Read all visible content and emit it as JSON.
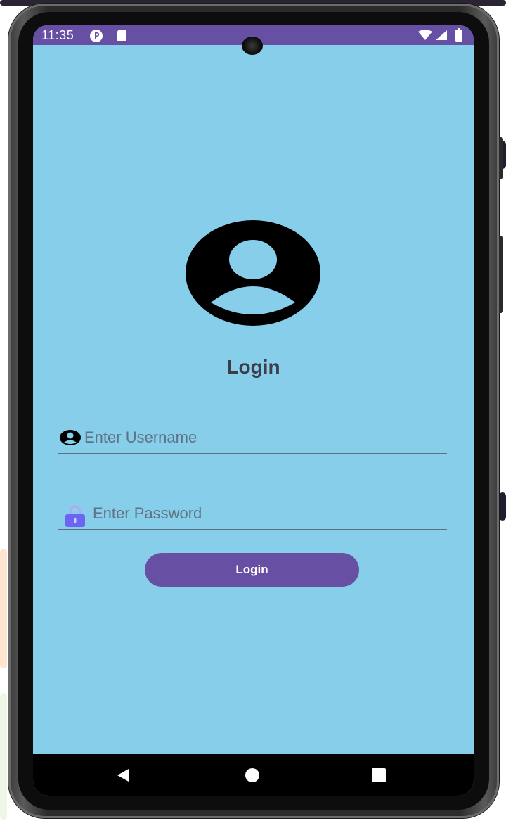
{
  "status_bar": {
    "time": "11:35",
    "left_icons": [
      "notification-p-icon",
      "sd-card-icon"
    ],
    "right_icons": [
      "wifi-icon",
      "signal-icon",
      "battery-icon"
    ],
    "color": "#6750a4"
  },
  "screen": {
    "background_color": "#87ceeb"
  },
  "login_form": {
    "avatar_icon": "account-circle-icon",
    "title": "Login",
    "username": {
      "icon": "person-icon",
      "placeholder": "Enter Username",
      "value": ""
    },
    "password": {
      "icon": "lock-icon",
      "placeholder": "Enter Password",
      "value": ""
    },
    "submit_label": "Login",
    "button_color": "#6750a4"
  },
  "nav_bar": {
    "buttons": [
      "back-icon",
      "home-icon",
      "recents-icon"
    ]
  }
}
